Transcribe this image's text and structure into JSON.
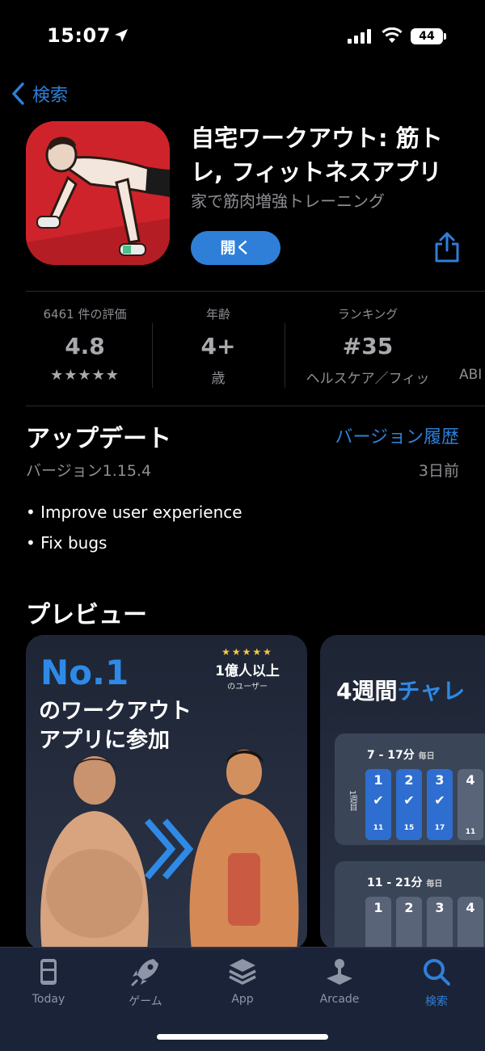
{
  "status": {
    "time": "15:07",
    "battery": "44"
  },
  "nav": {
    "back_label": "検索"
  },
  "app": {
    "title": "自宅ワークアウト: 筋トレ, フィットネスアプリ",
    "subtitle": "家で筋肉増強トレーニング",
    "open_label": "開く"
  },
  "info": {
    "ratings_label": "6461 件の評価",
    "rating_value": "4.8",
    "stars": "★★★★★",
    "rating_stars": 5,
    "age_label": "年齢",
    "age_value": "4+",
    "age_sub": "歳",
    "ranking_label": "ランキング",
    "ranking_value": "#35",
    "ranking_sub": "ヘルスケア／フィッ",
    "next_col_partial": "ABI"
  },
  "update": {
    "title": "アップデート",
    "history_label": "バージョン履歴",
    "version": "バージョン1.15.4",
    "date": "3日前",
    "notes": [
      "• Improve user experience",
      "• Fix bugs"
    ]
  },
  "preview": {
    "title": "プレビュー",
    "card1": {
      "headline": "No.1",
      "line1": "のワークアウト",
      "line2": "アプリに参加",
      "badge_stars": "★★★★★",
      "badge_main": "1億人以上",
      "badge_sub": "のユーザー"
    },
    "card2": {
      "title_white": "4週間",
      "title_blue": "チャレ",
      "week1_range": "7 - 17分",
      "week1_suffix": "毎日",
      "week2_range": "11 - 21分",
      "week2_suffix": "毎日",
      "side_label": "1週目",
      "week1_days": [
        "1",
        "2",
        "3",
        "4"
      ],
      "week1_minutes": [
        "11",
        "15",
        "17",
        "11"
      ],
      "week2_days": [
        "1",
        "2",
        "3",
        "4"
      ]
    }
  },
  "tabs": [
    {
      "label": "Today",
      "icon": "today-icon"
    },
    {
      "label": "ゲーム",
      "icon": "rocket-icon"
    },
    {
      "label": "App",
      "icon": "layers-icon"
    },
    {
      "label": "Arcade",
      "icon": "joystick-icon"
    },
    {
      "label": "検索",
      "icon": "search-icon"
    }
  ],
  "colors": {
    "accent": "#2f7fd8",
    "icon_red": "#d6262d",
    "background": "#000000"
  }
}
